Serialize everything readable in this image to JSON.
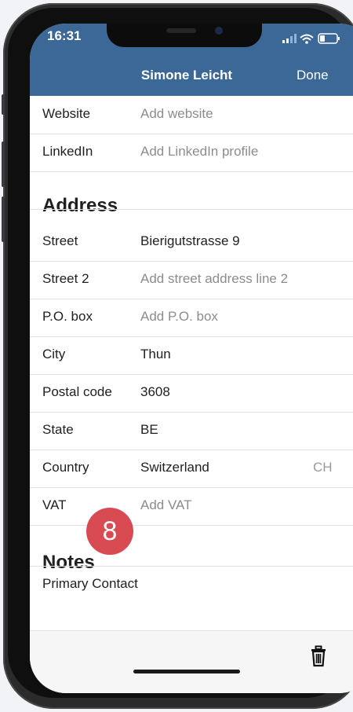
{
  "status": {
    "time": "16:31"
  },
  "nav": {
    "title": "Simone Leicht",
    "done_label": "Done"
  },
  "contact_rows": [
    {
      "label": "Website",
      "value": "Add website",
      "placeholder": true
    },
    {
      "label": "LinkedIn",
      "value": "Add LinkedIn profile",
      "placeholder": true
    }
  ],
  "address": {
    "title": "Address",
    "rows": [
      {
        "label": "Street",
        "value": "Bierigutstrasse 9",
        "placeholder": false
      },
      {
        "label": "Street 2",
        "value": "Add street address line 2",
        "placeholder": true
      },
      {
        "label": "P.O. box",
        "value": "Add P.O. box",
        "placeholder": true
      },
      {
        "label": "City",
        "value": "Thun",
        "placeholder": false
      },
      {
        "label": "Postal code",
        "value": "3608",
        "placeholder": false
      },
      {
        "label": "State",
        "value": "BE",
        "placeholder": false
      },
      {
        "label": "Country",
        "value": "Switzerland",
        "placeholder": false,
        "suffix": "CH"
      },
      {
        "label": "VAT",
        "value": "Add VAT",
        "placeholder": true
      }
    ]
  },
  "notes": {
    "title": "Notes",
    "text": "Primary Contact"
  },
  "step_marker": "8",
  "colors": {
    "header": "#3c6898",
    "marker": "#d84b52"
  }
}
